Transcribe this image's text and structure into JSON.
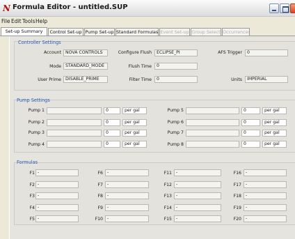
{
  "window": {
    "title": "Formula Editor - untitled.SUP",
    "app_icon_glyph": "N",
    "app_icon_color": "#b01010"
  },
  "menu": [
    "File",
    "Edit",
    "Tools",
    "Help"
  ],
  "tabs": [
    {
      "label": "Set-up Summary",
      "state": "active"
    },
    {
      "label": "Control Set-up",
      "state": "normal"
    },
    {
      "label": "Pump Set-up",
      "state": "normal"
    },
    {
      "label": "Standard Formulas",
      "state": "normal"
    },
    {
      "label": "Event Set-up",
      "state": "disabled"
    },
    {
      "label": "Group Select",
      "state": "disabled"
    },
    {
      "label": "Occurrences",
      "state": "disabled"
    }
  ],
  "controller": {
    "title": "Controller Settings",
    "account_label": "Account",
    "account_value": "NOVA CONTROLS",
    "mode_label": "Mode",
    "mode_value": "STANDARD_MODE",
    "user_prime_label": "User Prime",
    "user_prime_value": "DISABLE_PRIME",
    "configure_flush_label": "Configure Flush",
    "configure_flush_value": "ECLIPSE_PI",
    "flush_time_label": "Flush Time",
    "flush_time_value": "0",
    "filter_time_label": "Filter Time",
    "filter_time_value": "0",
    "afs_trigger_label": "AFS Trigger",
    "afs_trigger_value": "0",
    "units_label": "Units",
    "units_value": "IMPERIAL"
  },
  "pumps": {
    "title": "Pump Settings",
    "items": [
      {
        "label": "Pump 1",
        "name": "",
        "value": "0",
        "unit": "per gal"
      },
      {
        "label": "Pump 2",
        "name": "",
        "value": "0",
        "unit": "per gal"
      },
      {
        "label": "Pump 3",
        "name": "",
        "value": "0",
        "unit": "per gal"
      },
      {
        "label": "Pump 4",
        "name": "",
        "value": "0",
        "unit": "per gal"
      },
      {
        "label": "Pump 5",
        "name": "",
        "value": "0",
        "unit": "per gal"
      },
      {
        "label": "Pump 6",
        "name": "",
        "value": "0",
        "unit": "per gal"
      },
      {
        "label": "Pump 7",
        "name": "",
        "value": "0",
        "unit": "per gal"
      },
      {
        "label": "Pump 8",
        "name": "",
        "value": "0",
        "unit": "per gal"
      }
    ]
  },
  "formulas": {
    "title": "Formulas",
    "items": [
      {
        "label": "F1",
        "value": "-"
      },
      {
        "label": "F2",
        "value": "-"
      },
      {
        "label": "F3",
        "value": "-"
      },
      {
        "label": "F4",
        "value": "-"
      },
      {
        "label": "F5",
        "value": "-"
      },
      {
        "label": "F6",
        "value": "-"
      },
      {
        "label": "F7",
        "value": "-"
      },
      {
        "label": "F8",
        "value": "-"
      },
      {
        "label": "F9",
        "value": "-"
      },
      {
        "label": "F10",
        "value": "-"
      },
      {
        "label": "F11",
        "value": "-"
      },
      {
        "label": "F12",
        "value": "-"
      },
      {
        "label": "F13",
        "value": "-"
      },
      {
        "label": "F14",
        "value": "-"
      },
      {
        "label": "F15",
        "value": "-"
      },
      {
        "label": "F16",
        "value": "-"
      },
      {
        "label": "F17",
        "value": "-"
      },
      {
        "label": "F18",
        "value": "-"
      },
      {
        "label": "F19",
        "value": "-"
      },
      {
        "label": "F20",
        "value": "-"
      }
    ]
  }
}
